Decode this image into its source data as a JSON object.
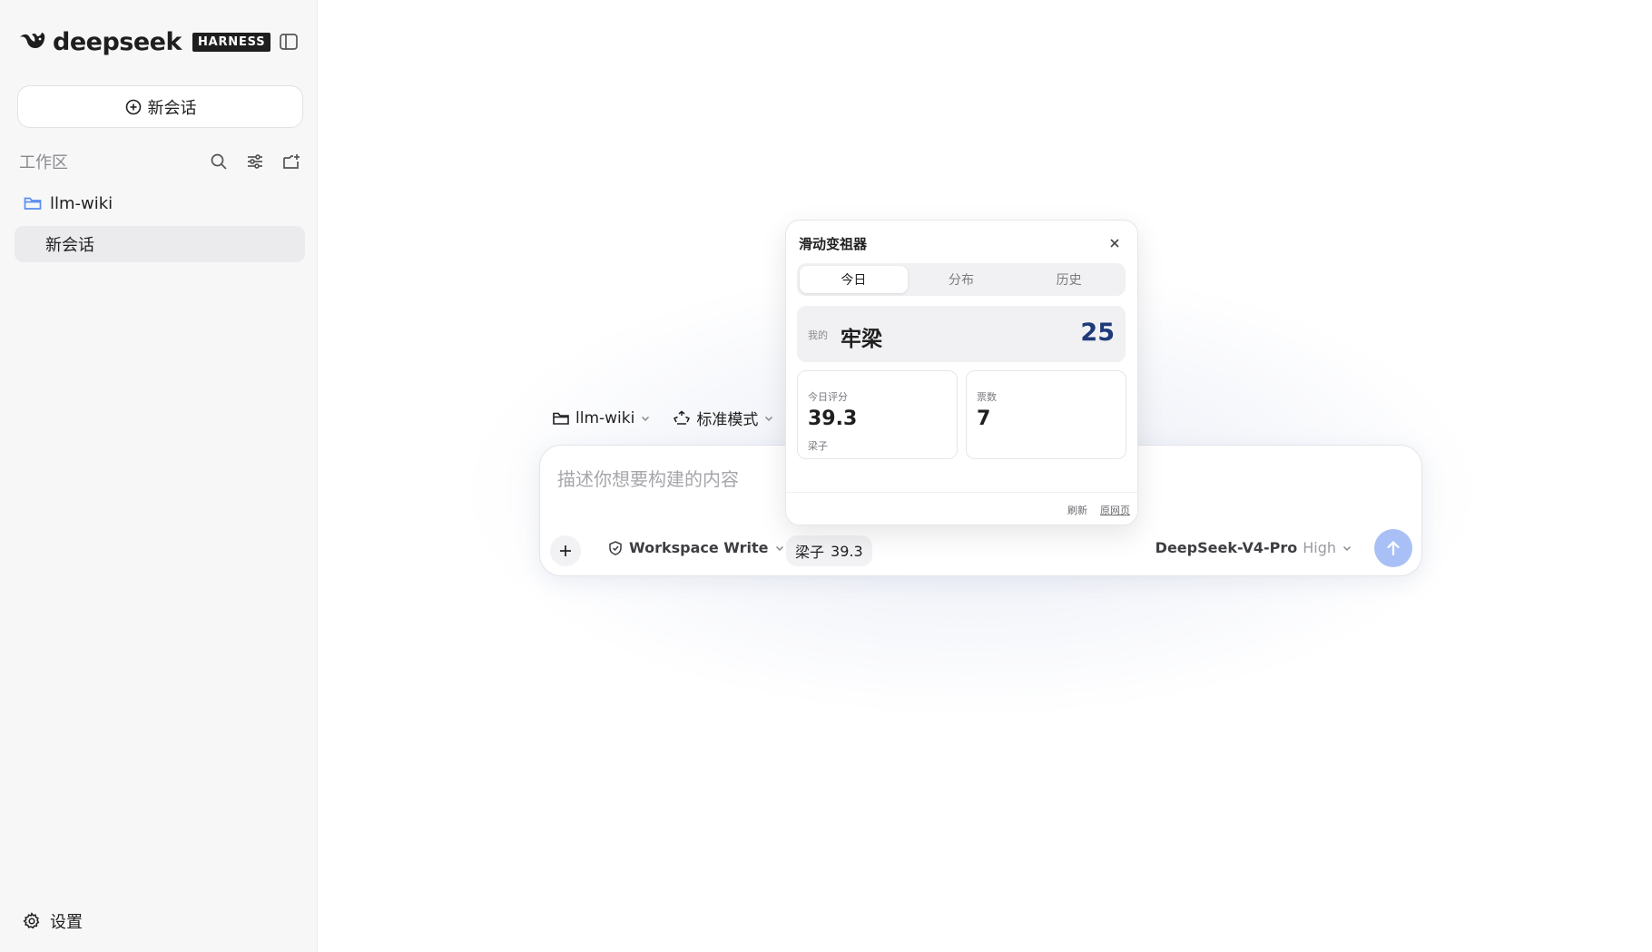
{
  "sidebar": {
    "brand_name": "deepseek",
    "brand_badge": "HARNESS",
    "new_chat_label": "新会话",
    "workspace_title": "工作区",
    "folder_name": "llm-wiki",
    "session_label": "新会话",
    "settings_label": "设置"
  },
  "context_bar": {
    "folder": "llm-wiki",
    "mode": "标准模式"
  },
  "composer": {
    "placeholder": "描述你想要构建的内容",
    "permission": "Workspace Write",
    "score_chip": {
      "name": "梁子",
      "value": "39.3"
    },
    "model": {
      "name": "DeepSeek-V4-Pro",
      "level": "High"
    }
  },
  "popup": {
    "title": "滑动变祖器",
    "tabs": [
      "今日",
      "分布",
      "历史"
    ],
    "active_tab": "今日",
    "mine": {
      "label": "我的",
      "name": "牢梁",
      "value": "25"
    },
    "stat_score": {
      "label": "今日评分",
      "value": "39.3",
      "sub": "梁子"
    },
    "stat_votes": {
      "label": "票数",
      "value": "7"
    },
    "footer": {
      "refresh": "刷新",
      "source": "原网页"
    }
  },
  "colors": {
    "accent_dark": "#1e3a7a",
    "send_button": "#a9c0f6",
    "folder_icon": "#5b8def"
  }
}
